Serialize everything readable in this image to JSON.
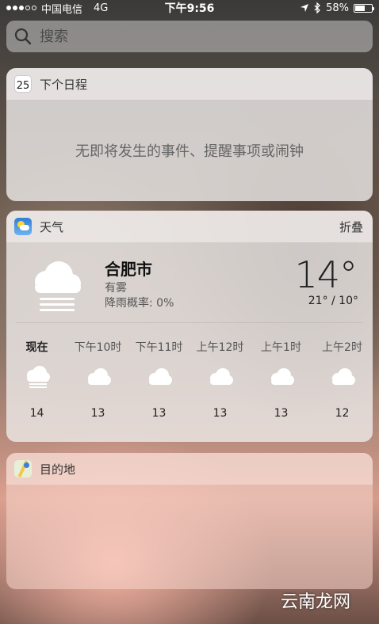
{
  "status_bar": {
    "carrier": "中国电信",
    "network": "4G",
    "time": "下午9:56",
    "battery_percent": "58%",
    "battery_level": 0.58
  },
  "search": {
    "placeholder": "搜索"
  },
  "calendar_widget": {
    "title": "下个日程",
    "icon_day": "25",
    "empty_message": "无即将发生的事件、提醒事项或闹钟"
  },
  "weather_widget": {
    "title": "天气",
    "collapse_label": "折叠",
    "city": "合肥市",
    "condition": "有雾",
    "rain_chance": "降雨概率: 0%",
    "temp_now": "14°",
    "temp_range": "21° / 10°",
    "hourly": [
      {
        "label": "现在",
        "temp": "14",
        "icon": "fog-icon"
      },
      {
        "label": "下午10时",
        "temp": "13",
        "icon": "cloud-icon"
      },
      {
        "label": "下午11时",
        "temp": "13",
        "icon": "cloud-icon"
      },
      {
        "label": "上午12时",
        "temp": "13",
        "icon": "cloud-icon"
      },
      {
        "label": "上午1时",
        "temp": "13",
        "icon": "cloud-icon"
      },
      {
        "label": "上午2时",
        "temp": "12",
        "icon": "cloud-icon"
      }
    ]
  },
  "destination_widget": {
    "title": "目的地"
  },
  "watermark": "云南龙网"
}
